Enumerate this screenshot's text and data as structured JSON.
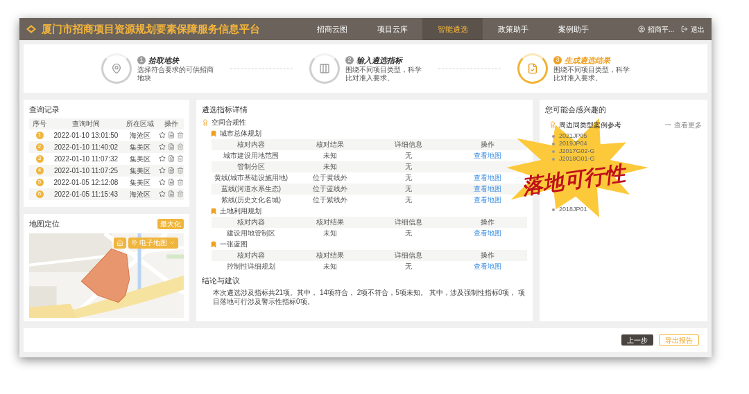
{
  "header": {
    "title": "厦门市招商项目资源规划要素保障服务信息平台",
    "nav": [
      {
        "label": "招商云图",
        "selected": false
      },
      {
        "label": "项目云库",
        "selected": false
      },
      {
        "label": "智能遴选",
        "selected": true
      },
      {
        "label": "政策助手",
        "selected": false
      },
      {
        "label": "案例助手",
        "selected": false
      }
    ],
    "user": "招商平...",
    "logout": "退出"
  },
  "steps": [
    {
      "number": "1",
      "title": "拾取地块",
      "description": "选择符合要求的可供招商地块",
      "selected": false
    },
    {
      "number": "2",
      "title": "输入遴选指标",
      "description": "围绕不同项目类型，科学比对准入要求。",
      "selected": false
    },
    {
      "number": "3",
      "title": "生成遴选结果",
      "description": "围绕不同项目类型，科学比对准入要求。",
      "selected": true
    }
  ],
  "history": {
    "title": "查询记录",
    "columns": [
      "序号",
      "查询时间",
      "所在区域",
      "操作"
    ],
    "rows": [
      {
        "index": "1",
        "time": "2022-01-10 13:01:50",
        "district": "海沧区"
      },
      {
        "index": "2",
        "time": "2022-01-10 11:40:02",
        "district": "集美区"
      },
      {
        "index": "3",
        "time": "2022-01-10 11:07:32",
        "district": "集美区"
      },
      {
        "index": "4",
        "time": "2022-01-10 11:07:25",
        "district": "集美区"
      },
      {
        "index": "5",
        "time": "2022-01-05 12:12:08",
        "district": "集美区"
      },
      {
        "index": "6",
        "time": "2022-01-05 11:15:43",
        "district": "海沧区"
      }
    ]
  },
  "map": {
    "title": "地图定位",
    "maximize": "最大化",
    "layer": "电子地图"
  },
  "details": {
    "title": "遴选指标详情",
    "groups": [
      {
        "label": "空间合规性",
        "children": [
          {
            "label": "城市总体规划",
            "columns": [
              "核对内容",
              "核对结果",
              "详细信息",
              "操作"
            ],
            "rows": [
              {
                "content": "城市建设用地范围",
                "result": "未知",
                "info": "无",
                "action": "查看地图"
              },
              {
                "content": "管制分区",
                "result": "未知",
                "info": "无"
              },
              {
                "content": "黄线(城市基础设施用地)",
                "result": "位于黄线外",
                "info": "无",
                "action": "查看地图"
              },
              {
                "content": "蓝线(河道水系生态)",
                "result": "位于蓝线外",
                "info": "无",
                "action": "查看地图"
              },
              {
                "content": "紫线(历史文化名城)",
                "result": "位于紫线外",
                "info": "无",
                "action": "查看地图"
              }
            ]
          },
          {
            "label": "土地利用规划",
            "columns": [
              "核对内容",
              "核对结果",
              "详细信息",
              "操作"
            ],
            "rows": [
              {
                "content": "建设用地管制区",
                "result": "未知",
                "info": "无",
                "action": "查看地图"
              }
            ]
          },
          {
            "label": "一张蓝图",
            "columns": [
              "核对内容",
              "核对结果",
              "详细信息",
              "操作"
            ],
            "rows": [
              {
                "content": "控制性详细规划",
                "result": "未知",
                "info": "无",
                "action": "查看地图"
              }
            ]
          }
        ]
      }
    ],
    "conclusion": {
      "title": "结论与建议",
      "text": "本次遴选涉及指标共21项。其中， 14项符合， 2项不符合，5项未知。 其中，涉及强制性指标0项， 项目落地可行涉及警示性指标0项。"
    }
  },
  "suggestions": {
    "title": "您可能会感兴趣的",
    "section": "周边同类型案例参考",
    "more": "查看更多",
    "items": [
      "2021JP05",
      "2019JP04",
      "J2017G02-G",
      "J2018G01-G",
      "2018JP01"
    ]
  },
  "callout": {
    "text": "落地可行性"
  },
  "footer": {
    "buttons": [
      {
        "label": "上一步",
        "kind": "primary"
      },
      {
        "label": "导出报告",
        "kind": "outline"
      }
    ]
  }
}
